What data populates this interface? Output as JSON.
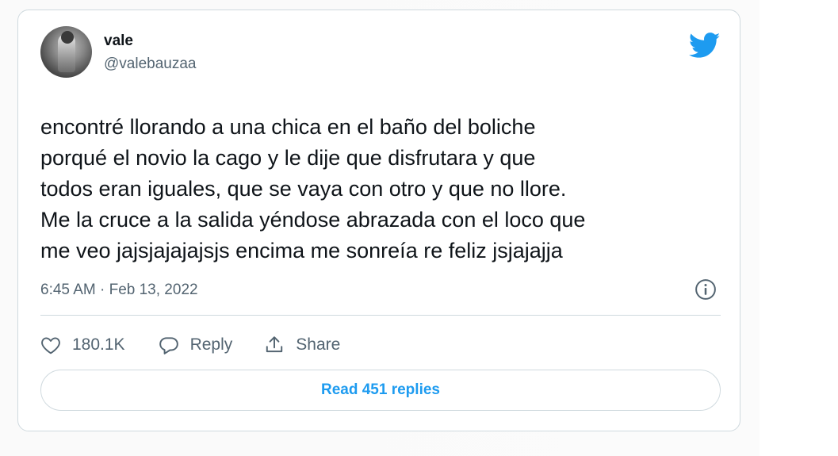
{
  "colors": {
    "accent": "#1d9bf0",
    "text_primary": "#0f1419",
    "text_secondary": "#536471",
    "border": "#cfd9de"
  },
  "tweet": {
    "author": {
      "name": "vale",
      "handle": "@valebauzaa",
      "avatar_icon": "profile-photo"
    },
    "brand_icon": "twitter-bird-icon",
    "text": "encontré llorando a una chica en el baño del boliche\nporqué el novio la cago y le dije que disfrutara y que\ntodos eran iguales, que se vaya con otro y que no llore.\nMe la cruce a la salida yéndose abrazada con el loco que\nme veo jajsjajajajsjs encima me sonreía re feliz jsjajajja",
    "timestamp": "6:45 AM · Feb 13, 2022",
    "info_icon": "info-icon",
    "actions": {
      "like": {
        "icon": "heart-icon",
        "label": "180.1K"
      },
      "reply": {
        "icon": "speech-bubble-icon",
        "label": "Reply"
      },
      "share": {
        "icon": "share-upload-icon",
        "label": "Share"
      }
    },
    "read_replies_label": "Read 451 replies"
  }
}
